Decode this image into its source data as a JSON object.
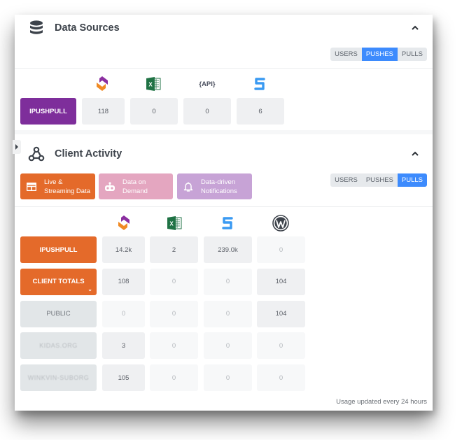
{
  "data_sources": {
    "title": "Data Sources",
    "icon": "database-icon",
    "collapse_icon": "chevron-up-icon",
    "segmented": {
      "options": [
        "USERS",
        "PUSHES",
        "PULLS"
      ],
      "active": "PUSHES"
    },
    "columns": [
      {
        "icon": "ipushpull-logo-icon"
      },
      {
        "icon": "excel-icon"
      },
      {
        "icon": "api-icon",
        "label": "{API}"
      },
      {
        "icon": "symphony-icon"
      }
    ],
    "rows": [
      {
        "label": "IPUSHPULL",
        "color": "#7e2e9b",
        "values": [
          "118",
          "0",
          "0",
          "6"
        ]
      }
    ]
  },
  "client_activity": {
    "title": "Client Activity",
    "icon": "webhook-icon",
    "collapse_icon": "chevron-up-icon",
    "features": [
      {
        "label_line1": "Live &",
        "label_line2": "Streaming Data",
        "icon": "table-icon",
        "color": "#e46a2a"
      },
      {
        "label_line1": "Data on",
        "label_line2": "Demand",
        "icon": "robot-icon",
        "color": "#e4a6c0"
      },
      {
        "label_line1": "Data-driven",
        "label_line2": "Notifications",
        "icon": "bell-icon",
        "color": "#c7a3d6"
      }
    ],
    "segmented": {
      "options": [
        "USERS",
        "PUSHES",
        "PULLS"
      ],
      "active": "PULLS"
    },
    "columns": [
      {
        "icon": "ipushpull-logo-icon"
      },
      {
        "icon": "excel-icon"
      },
      {
        "icon": "symphony-icon"
      },
      {
        "icon": "wordpress-icon"
      }
    ],
    "rows": [
      {
        "label": "IPUSHPULL",
        "style": "orange",
        "values": [
          "14.2k",
          "2",
          "239.0k",
          "0"
        ]
      },
      {
        "label": "CLIENT TOTALS",
        "style": "orange",
        "expand_icon": "chevron-down-icon",
        "values": [
          "108",
          "0",
          "0",
          "104"
        ]
      },
      {
        "label": "PUBLIC",
        "style": "grey",
        "values": [
          "0",
          "0",
          "0",
          "104"
        ]
      },
      {
        "label": "KIDAS.ORG",
        "style": "grey-blurred",
        "values": [
          "3",
          "0",
          "0",
          "0"
        ]
      },
      {
        "label": "WINKVIN-SUBORG",
        "style": "grey-blurred",
        "values": [
          "105",
          "0",
          "0",
          "0"
        ]
      }
    ],
    "footer_note": "Usage updated every 24 hours"
  },
  "side_toggle_icon": "caret-right-icon"
}
